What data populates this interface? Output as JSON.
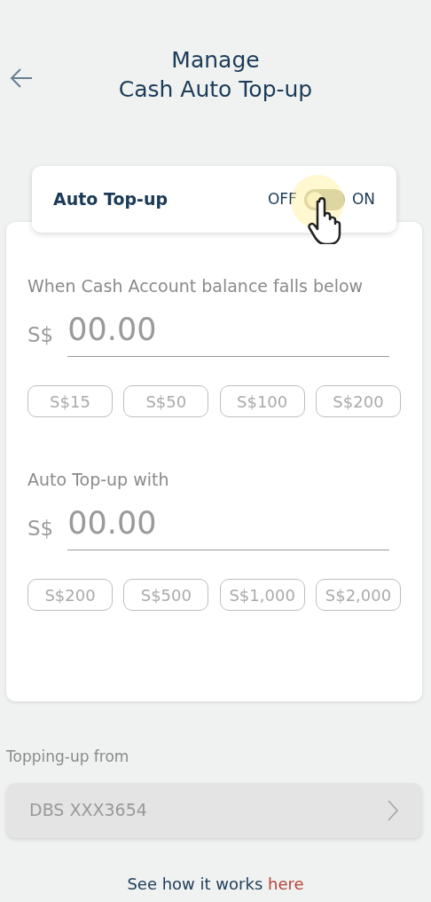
{
  "header": {
    "title_lines": [
      "Manage",
      "Cash Auto Top-up"
    ]
  },
  "auto_topup": {
    "label": "Auto Top-up",
    "off_label": "OFF",
    "on_label": "ON",
    "on": false
  },
  "sections": [
    {
      "label": "When Cash Account balance falls below",
      "currency": "S$",
      "placeholder": "00.00",
      "presets": [
        "S$15",
        "S$50",
        "S$100",
        "S$200"
      ]
    },
    {
      "label": "Auto Top-up with",
      "currency": "S$",
      "placeholder": "00.00",
      "presets": [
        "S$200",
        "S$500",
        "S$1,000",
        "S$2,000"
      ]
    }
  ],
  "source": {
    "label": "Topping-up from",
    "account": "DBS XXX3654"
  },
  "footer": {
    "text": "See how it works",
    "link": "here"
  }
}
